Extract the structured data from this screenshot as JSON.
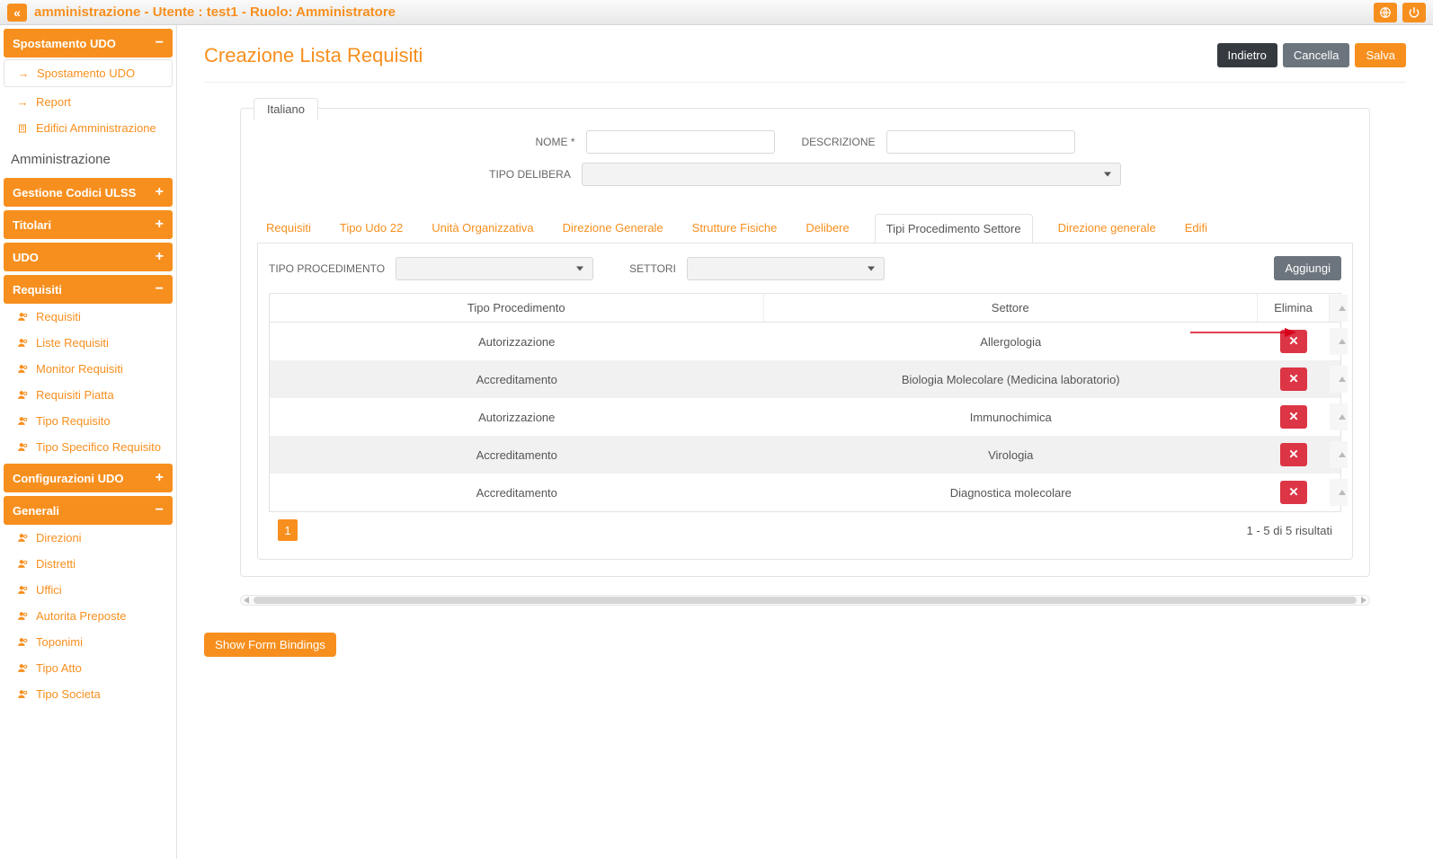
{
  "topbar": {
    "title": "amministrazione - Utente : test1 - Ruolo: Amministratore"
  },
  "sidebar": {
    "spostamento": {
      "header": "Spostamento UDO",
      "items": [
        {
          "label": "Spostamento UDO",
          "icon": "arrow"
        },
        {
          "label": "Report",
          "icon": "arrow"
        },
        {
          "label": "Edifici Amministrazione",
          "icon": "building"
        }
      ]
    },
    "section_title": "Amministrazione",
    "groups": [
      {
        "header": "Gestione Codici ULSS",
        "collapsed": true
      },
      {
        "header": "Titolari",
        "collapsed": true
      },
      {
        "header": "UDO",
        "collapsed": true
      },
      {
        "header": "Requisiti",
        "collapsed": false,
        "items": [
          {
            "label": "Requisiti"
          },
          {
            "label": "Liste Requisiti"
          },
          {
            "label": "Monitor Requisiti"
          },
          {
            "label": "Requisiti Piatta"
          },
          {
            "label": "Tipo Requisito"
          },
          {
            "label": "Tipo Specifico Requisito"
          }
        ]
      },
      {
        "header": "Configurazioni UDO",
        "collapsed": true
      },
      {
        "header": "Generali",
        "collapsed": false,
        "items": [
          {
            "label": "Direzioni"
          },
          {
            "label": "Distretti"
          },
          {
            "label": "Uffici"
          },
          {
            "label": "Autorita Preposte"
          },
          {
            "label": "Toponimi"
          },
          {
            "label": "Tipo Atto"
          },
          {
            "label": "Tipo Societa"
          }
        ]
      }
    ]
  },
  "page": {
    "title": "Creazione Lista Requisiti",
    "buttons": {
      "back": "Indietro",
      "cancel": "Cancella",
      "save": "Salva"
    },
    "lang_tab": "Italiano",
    "labels": {
      "nome": "NOME *",
      "descrizione": "DESCRIZIONE",
      "tipo_delibera": "TIPO DELIBERA",
      "tipo_procedimento": "TIPO PROCEDIMENTO",
      "settori": "SETTORI",
      "aggiungi": "Aggiungi"
    },
    "tabs": [
      "Requisiti",
      "Tipo Udo 22",
      "Unità Organizzativa",
      "Direzione Generale",
      "Strutture Fisiche",
      "Delibere",
      "Tipi Procedimento Settore",
      "Direzione generale",
      "Edifi"
    ],
    "active_tab_index": 6,
    "table": {
      "columns": [
        "Tipo Procedimento",
        "Settore",
        "Elimina"
      ],
      "rows": [
        {
          "proc": "Autorizzazione",
          "settore": "Allergologia"
        },
        {
          "proc": "Accreditamento",
          "settore": "Biologia Molecolare (Medicina laboratorio)"
        },
        {
          "proc": "Autorizzazione",
          "settore": "Immunochimica"
        },
        {
          "proc": "Accreditamento",
          "settore": "Virologia"
        },
        {
          "proc": "Accreditamento",
          "settore": "Diagnostica molecolare"
        }
      ],
      "footer": "1 - 5 di 5 risultati",
      "page_current": "1"
    },
    "show_bindings": "Show Form Bindings"
  }
}
